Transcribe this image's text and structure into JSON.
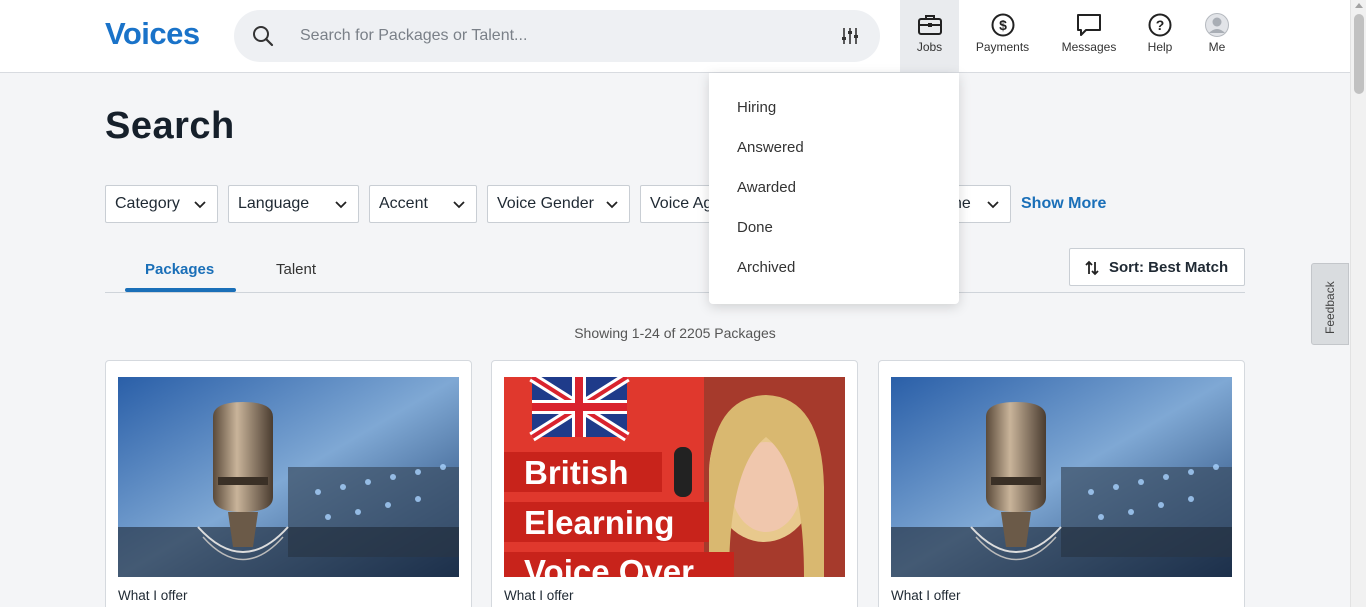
{
  "header": {
    "logo": "Voices",
    "search_placeholder": "Search for Packages or Talent...",
    "nav": {
      "jobs": "Jobs",
      "payments": "Payments",
      "messages": "Messages",
      "help": "Help",
      "me": "Me"
    }
  },
  "page": {
    "title": "Search",
    "filters": [
      "Category",
      "Language",
      "Accent",
      "Voice Gender",
      "Voice Ag",
      "ne"
    ],
    "show_more": "Show More",
    "tabs": [
      "Packages",
      "Talent"
    ],
    "sort_label": "Sort: Best Match",
    "showing": "Showing 1-24 of 2205 Packages"
  },
  "jobs_menu": {
    "items": [
      "Hiring",
      "Answered",
      "Awarded",
      "Done",
      "Archived"
    ]
  },
  "cards": [
    {
      "caption": "What I offer",
      "image": "studio-microphone"
    },
    {
      "caption": "What I offer",
      "image": "british-elearning-banner",
      "overlay_lines": [
        "British",
        "Elearning",
        "Voice Over"
      ]
    },
    {
      "caption": "What I offer",
      "image": "studio-microphone"
    }
  ],
  "feedback_label": "Feedback",
  "colors": {
    "brand": "#1a73c9",
    "link": "#1a6fb8",
    "banner_red": "#e0382d"
  }
}
